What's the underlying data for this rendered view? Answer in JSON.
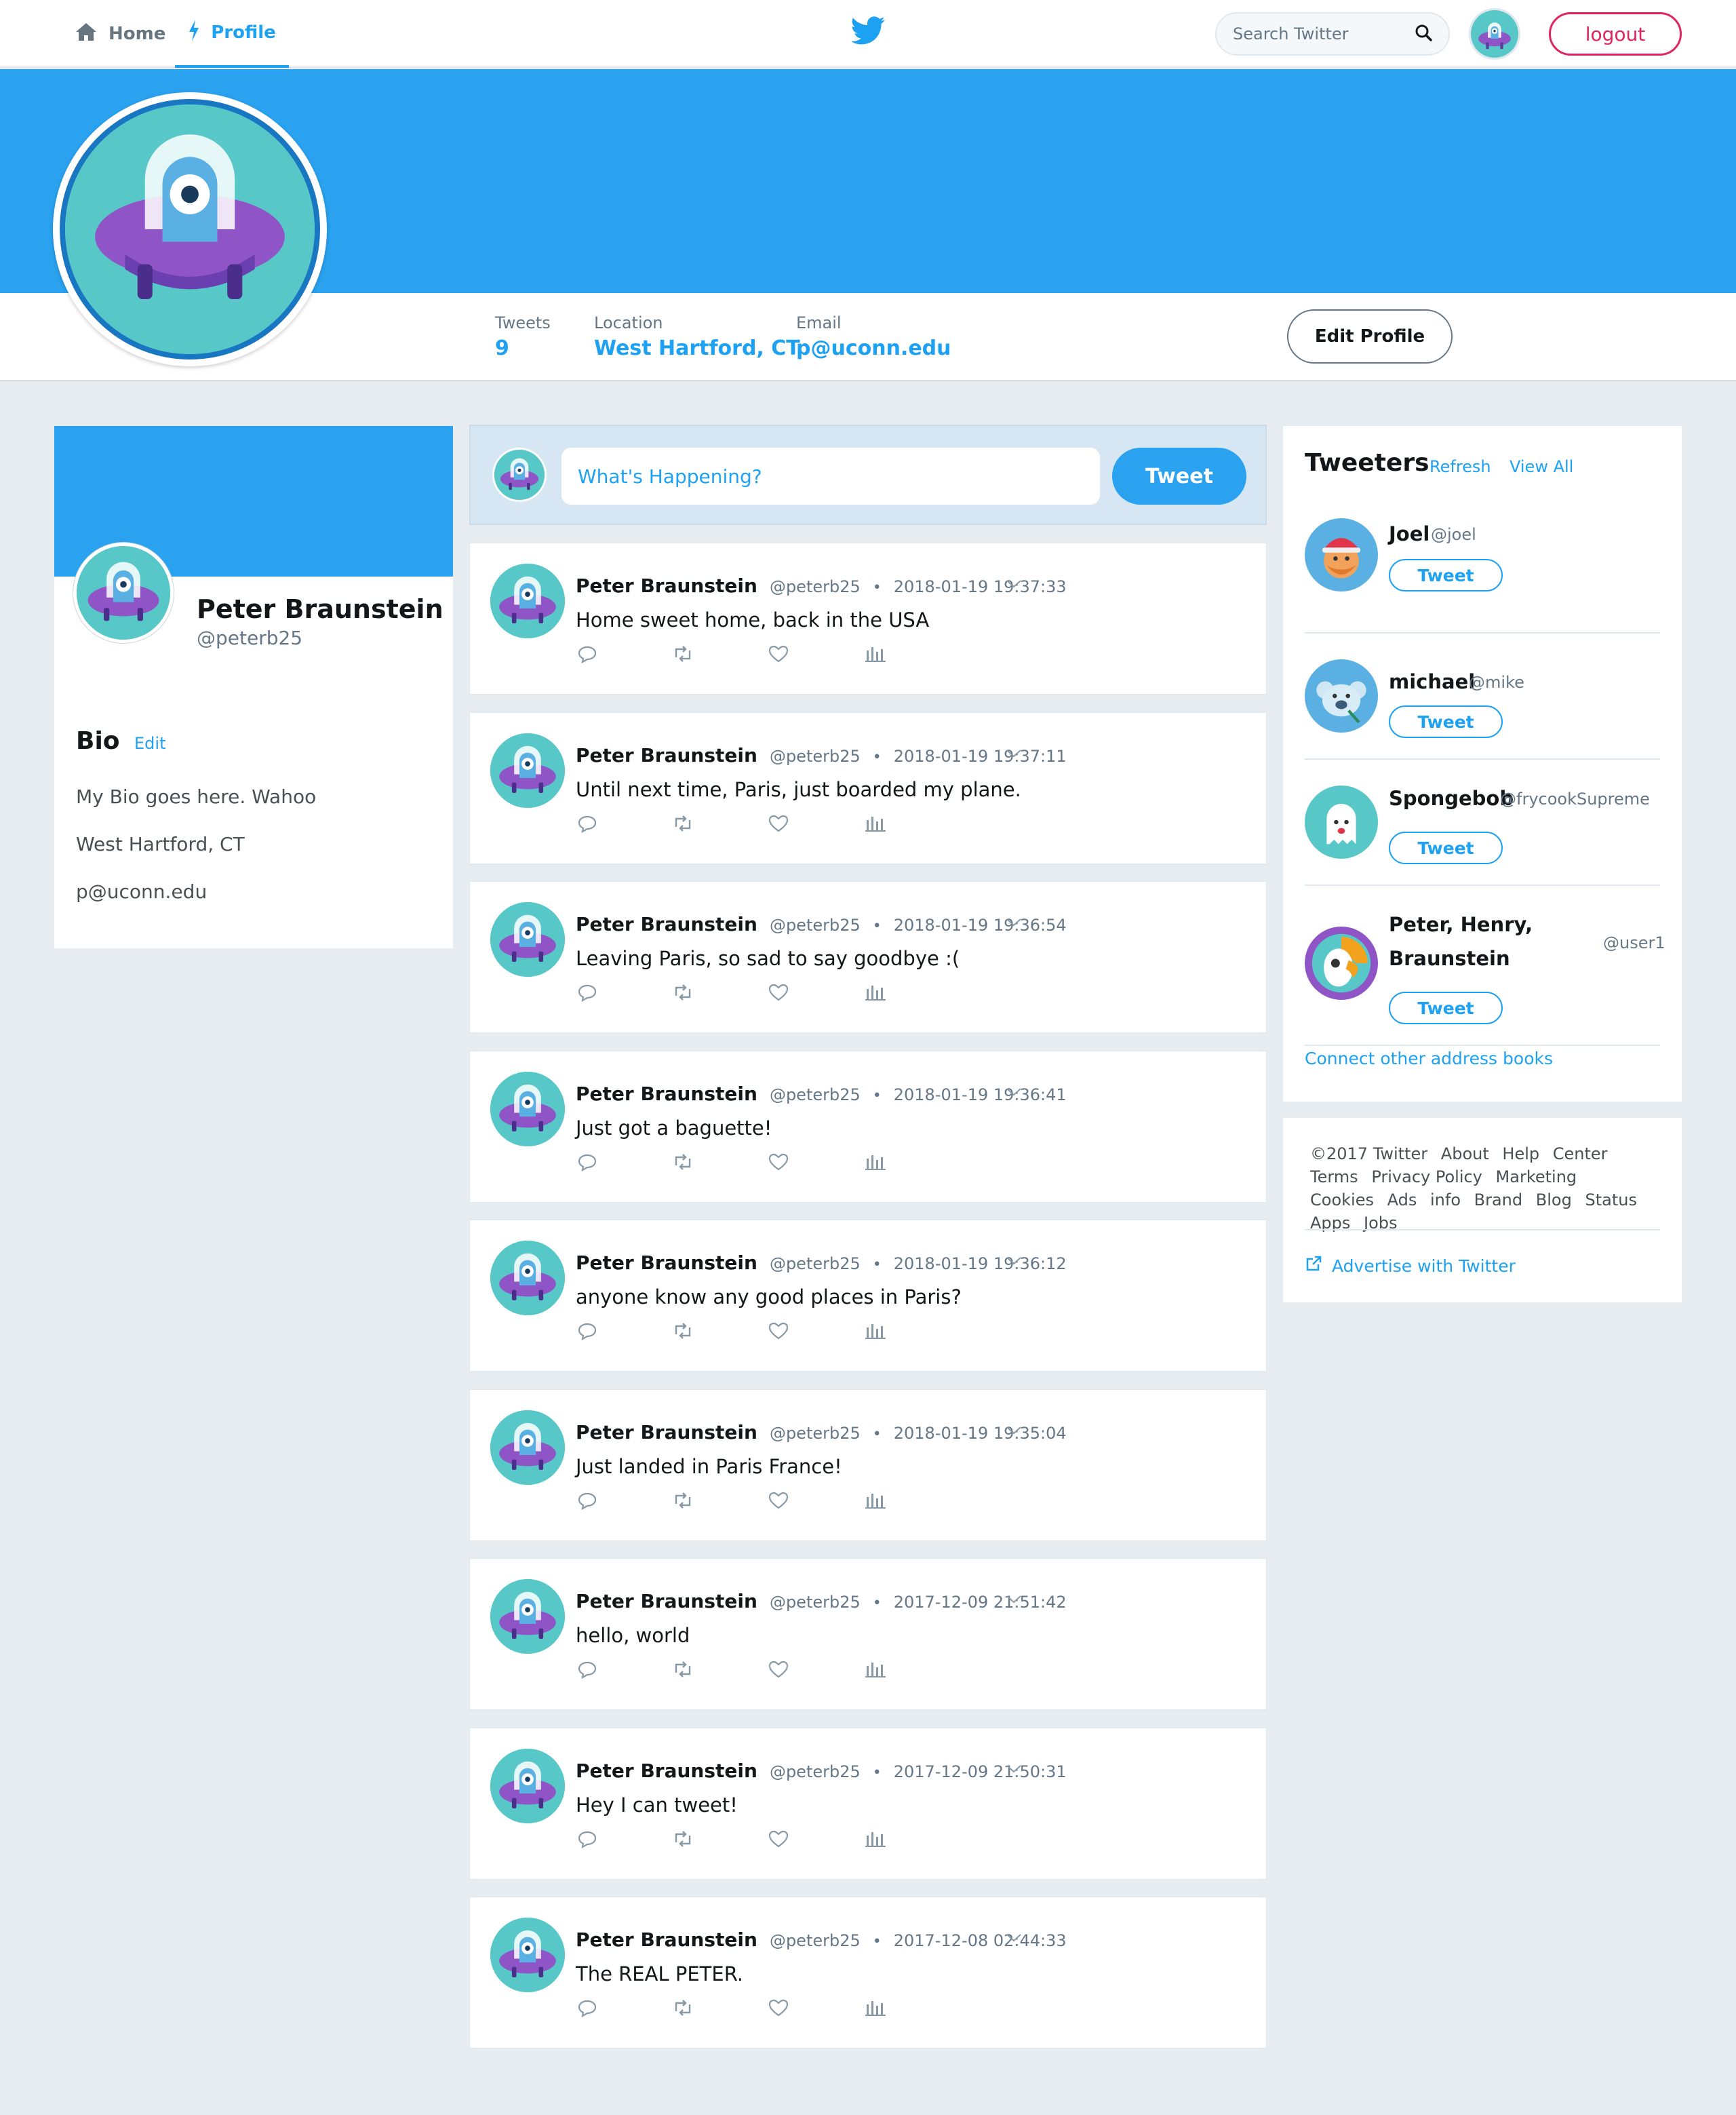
{
  "nav": {
    "home_label": "Home",
    "profile_label": "Profile",
    "search_placeholder": "Search Twitter",
    "logout_label": "logout",
    "accent_color": "#1da1f2"
  },
  "profile_stats": {
    "tweets_label": "Tweets",
    "tweets_value": "9",
    "location_label": "Location",
    "location_value": "West Hartford, CT",
    "email_label": "Email",
    "email_value": "p@uconn.edu",
    "edit_profile_label": "Edit Profile"
  },
  "left_card": {
    "name": "Peter Braunstein",
    "handle": "@peterb25",
    "bio_title": "Bio",
    "bio_edit": "Edit",
    "bio_lines": [
      "My Bio goes here. Wahoo",
      "West Hartford, CT",
      "p@uconn.edu"
    ]
  },
  "composer": {
    "placeholder": "What's Happening?",
    "tweet_button": "Tweet"
  },
  "tweets": [
    {
      "name": "Peter Braunstein",
      "handle": "@peterb25",
      "dot": "•",
      "time": "2018-01-19 19:37:33",
      "text": "Home sweet home, back in the USA"
    },
    {
      "name": "Peter Braunstein",
      "handle": "@peterb25",
      "dot": "•",
      "time": "2018-01-19 19:37:11",
      "text": "Until next time, Paris, just boarded my plane."
    },
    {
      "name": "Peter Braunstein",
      "handle": "@peterb25",
      "dot": "•",
      "time": "2018-01-19 19:36:54",
      "text": "Leaving Paris, so sad to say goodbye :("
    },
    {
      "name": "Peter Braunstein",
      "handle": "@peterb25",
      "dot": "•",
      "time": "2018-01-19 19:36:41",
      "text": "Just got a baguette!"
    },
    {
      "name": "Peter Braunstein",
      "handle": "@peterb25",
      "dot": "•",
      "time": "2018-01-19 19:36:12",
      "text": "anyone know any good places in Paris?"
    },
    {
      "name": "Peter Braunstein",
      "handle": "@peterb25",
      "dot": "•",
      "time": "2018-01-19 19:35:04",
      "text": "Just landed in Paris France!"
    },
    {
      "name": "Peter Braunstein",
      "handle": "@peterb25",
      "dot": "•",
      "time": "2017-12-09 21:51:42",
      "text": "hello, world"
    },
    {
      "name": "Peter Braunstein",
      "handle": "@peterb25",
      "dot": "•",
      "time": "2017-12-09 21:50:31",
      "text": "Hey I can tweet!"
    },
    {
      "name": "Peter Braunstein",
      "handle": "@peterb25",
      "dot": "•",
      "time": "2017-12-08 02:44:33",
      "text": "The REAL PETER."
    }
  ],
  "tweeters": {
    "title": "Tweeters",
    "refresh": "Refresh",
    "view_all": "View All",
    "users": [
      {
        "name": "Joel",
        "handle": "@joel",
        "button": "Tweet"
      },
      {
        "name": "michael",
        "handle": "@mike",
        "button": "Tweet"
      },
      {
        "name": "Spongebob",
        "handle": "@frycookSupreme",
        "button": "Tweet"
      },
      {
        "name_line1": "Peter, Henry,",
        "name_line2": "Braunstein",
        "handle": "@user1",
        "button": "Tweet"
      }
    ],
    "connect": "Connect other address books"
  },
  "footer": {
    "links": [
      "©2017 Twitter",
      "About",
      "Help",
      "Center",
      "Terms",
      "Privacy Policy",
      "Marketing",
      "Cookies",
      "Ads",
      "info",
      "Brand",
      "Blog",
      "Status",
      "Apps",
      "Jobs"
    ],
    "advertise": "Advertise with Twitter"
  }
}
